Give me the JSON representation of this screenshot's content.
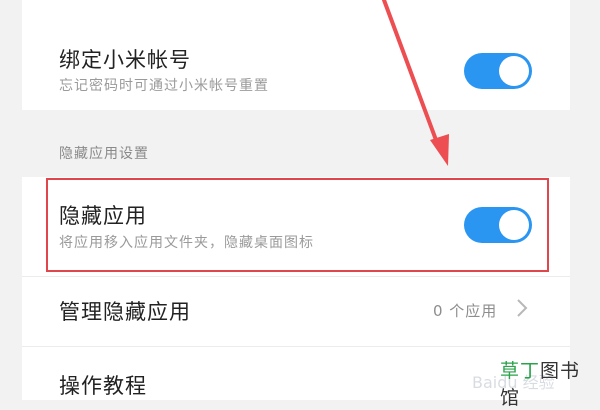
{
  "rows": {
    "bind_account": {
      "title": "绑定小米帐号",
      "subtitle": "忘记密码时可通过小米帐号重置",
      "toggle_on": true
    },
    "section_header": "隐藏应用设置",
    "hide_apps": {
      "title": "隐藏应用",
      "subtitle": "将应用移入应用文件夹，隐藏桌面图标",
      "toggle_on": true
    },
    "manage_hidden": {
      "title": "管理隐藏应用",
      "value": "0 个应用"
    },
    "tutorial": {
      "title": "操作教程"
    }
  },
  "branding": {
    "part1": "草丁",
    "part2": "图书馆",
    "watermark": "Baidu 经验"
  },
  "colors": {
    "toggle_on": "#2b95f2",
    "highlight_box": "#e0474c",
    "arrow": "#ec4e52",
    "brand_green": "#2aa34a"
  },
  "icons": {
    "chevron": "chevron-right-icon"
  }
}
